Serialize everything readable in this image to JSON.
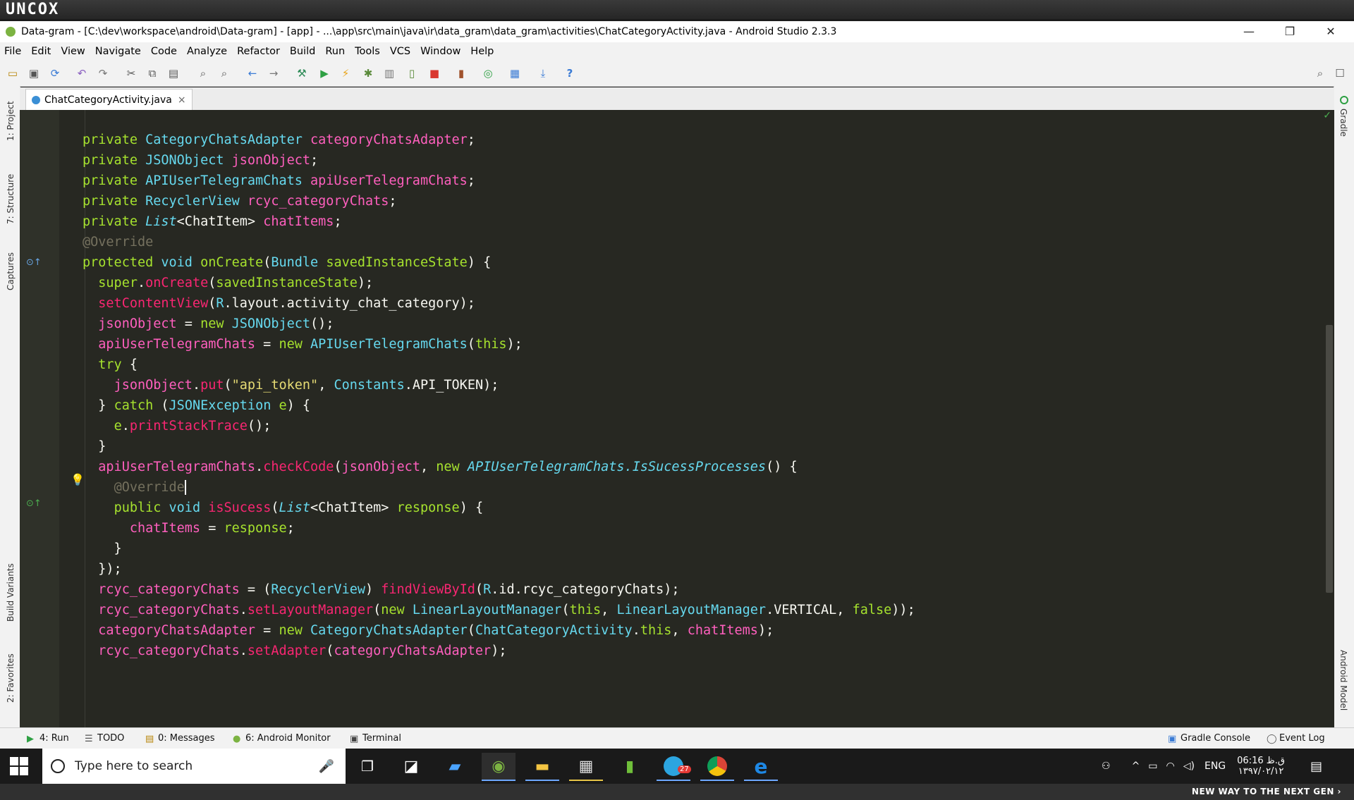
{
  "brand": "UNCOX",
  "window": {
    "title": "Data-gram - [C:\\dev\\workspace\\android\\Data-gram] - [app] - ...\\app\\src\\main\\java\\ir\\data_gram\\data_gram\\activities\\ChatCategoryActivity.java - Android Studio 2.3.3",
    "minimize": "—",
    "restore": "❐",
    "close": "✕"
  },
  "menu": [
    "File",
    "Edit",
    "View",
    "Navigate",
    "Code",
    "Analyze",
    "Refactor",
    "Build",
    "Run",
    "Tools",
    "VCS",
    "Window",
    "Help"
  ],
  "toolbar_icons": [
    "open-icon",
    "save-icon",
    "sync-icon",
    "undo-icon",
    "redo-icon",
    "cut-icon",
    "copy-icon",
    "paste-icon",
    "find-icon",
    "replace-icon",
    "back-icon",
    "forward-icon",
    "make-project-icon",
    "run-icon",
    "instant-run-icon",
    "debug-icon",
    "profile-icon",
    "attach-debugger-icon",
    "stop-icon",
    "avd-manager-icon",
    "gradle-sync-icon",
    "project-structure-icon",
    "sdk-manager-icon",
    "help-icon"
  ],
  "editor_tab": {
    "label": "ChatCategoryActivity.java",
    "close": "×"
  },
  "left_tool_windows": [
    "1: Project",
    "7: Structure",
    "Captures",
    "Build Variants",
    "2: Favorites"
  ],
  "right_tool_windows": [
    "Gradle",
    "Android Model"
  ],
  "code_lines": [
    "private CategoryChatsAdapter categoryChatsAdapter;",
    "private JSONObject jsonObject;",
    "private APIUserTelegramChats apiUserTelegramChats;",
    "private RecyclerView rcyc_categoryChats;",
    "private List<ChatItem> chatItems;",
    "@Override",
    "protected void onCreate(Bundle savedInstanceState) {",
    "  super.onCreate(savedInstanceState);",
    "  setContentView(R.layout.activity_chat_category);",
    "  jsonObject = new JSONObject();",
    "  apiUserTelegramChats = new APIUserTelegramChats(this);",
    "  try {",
    "    jsonObject.put(\"api_token\", Constants.API_TOKEN);",
    "  } catch (JSONException e) {",
    "    e.printStackTrace();",
    "  }",
    "  apiUserTelegramChats.checkCode(jsonObject, new APIUserTelegramChats.IsSucessProcesses() {",
    "    @Override",
    "    public void isSucess(List<ChatItem> response) {",
    "      chatItems = response;",
    "    }",
    "  });",
    "  rcyc_categoryChats = (RecyclerView) findViewById(R.id.rcyc_categoryChats);",
    "  rcyc_categoryChats.setLayoutManager(new LinearLayoutManager(this, LinearLayoutManager.VERTICAL, false));",
    "  categoryChatsAdapter = new CategoryChatsAdapter(ChatCategoryActivity.this, chatItems);",
    "  rcyc_categoryChats.setAdapter(categoryChatsAdapter);"
  ],
  "statusbar": {
    "run": "4: Run",
    "todo": "TODO",
    "messages": "0: Messages",
    "android_monitor": "6: Android Monitor",
    "terminal": "Terminal",
    "gradle_console": "Gradle Console",
    "event_log": "Event Log"
  },
  "taskbar": {
    "search_placeholder": "Type here to search",
    "apps": [
      "task-view-icon",
      "sticky-notes-icon",
      "app-icon",
      "android-studio-icon",
      "file-explorer-icon",
      "film-app-icon",
      "green-app-icon",
      "telegram-icon",
      "chrome-icon",
      "edge-icon"
    ],
    "telegram_badge": "27",
    "language": "ENG",
    "time": "06:16 ق.ظ",
    "date": "۱۳۹۷/۰۲/۱۲"
  },
  "footer_slogan": "NEW WAY TO THE NEXT GEN ›"
}
